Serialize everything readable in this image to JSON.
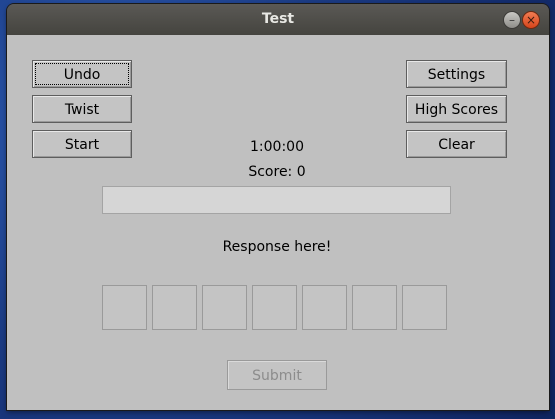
{
  "window": {
    "title": "Test"
  },
  "buttons": {
    "undo": "Undo",
    "twist": "Twist",
    "start": "Start",
    "settings": "Settings",
    "high_scores": "High Scores",
    "clear": "Clear",
    "submit": "Submit"
  },
  "timer": "1:00:00",
  "score": "Score: 0",
  "word_entry": {
    "value": ""
  },
  "response": "Response here!",
  "letter_tiles": [
    "",
    "",
    "",
    "",
    "",
    "",
    ""
  ],
  "icons": {
    "minimize": "minimize-icon",
    "close": "close-icon"
  }
}
